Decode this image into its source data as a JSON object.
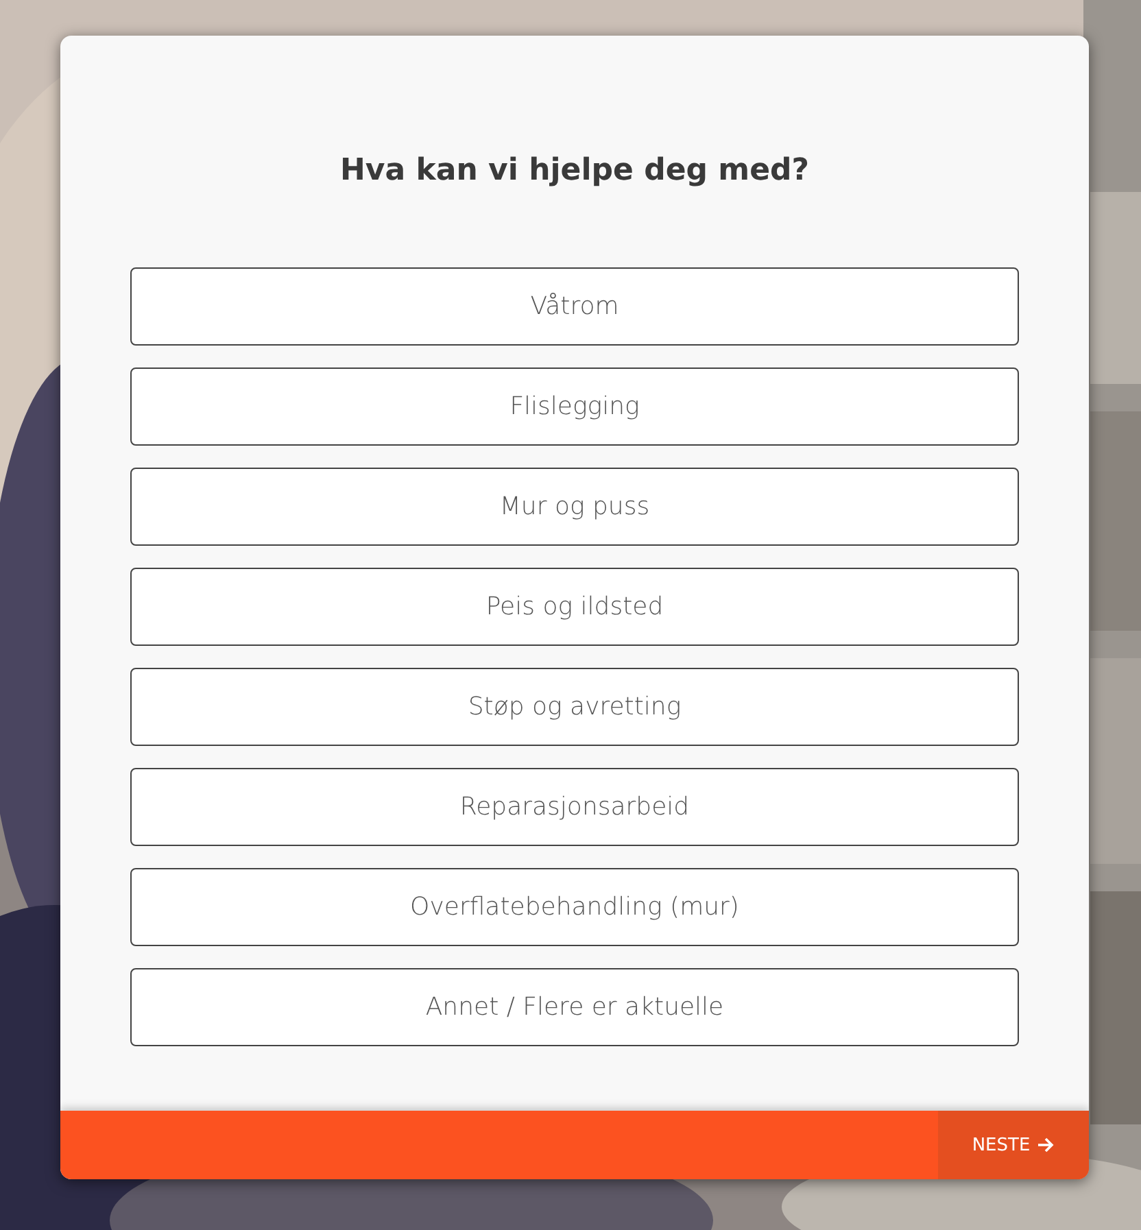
{
  "title": "Hva kan vi hjelpe deg med?",
  "options": [
    {
      "label": "Våtrom"
    },
    {
      "label": "Flislegging"
    },
    {
      "label": "Mur og puss"
    },
    {
      "label": "Peis og ildsted"
    },
    {
      "label": "Støp og avretting"
    },
    {
      "label": "Reparasjonsarbeid"
    },
    {
      "label": "Overflatebehandling (mur)"
    },
    {
      "label": "Annet / Flere er aktuelle"
    }
  ],
  "footer": {
    "next_button": "NESTE"
  }
}
